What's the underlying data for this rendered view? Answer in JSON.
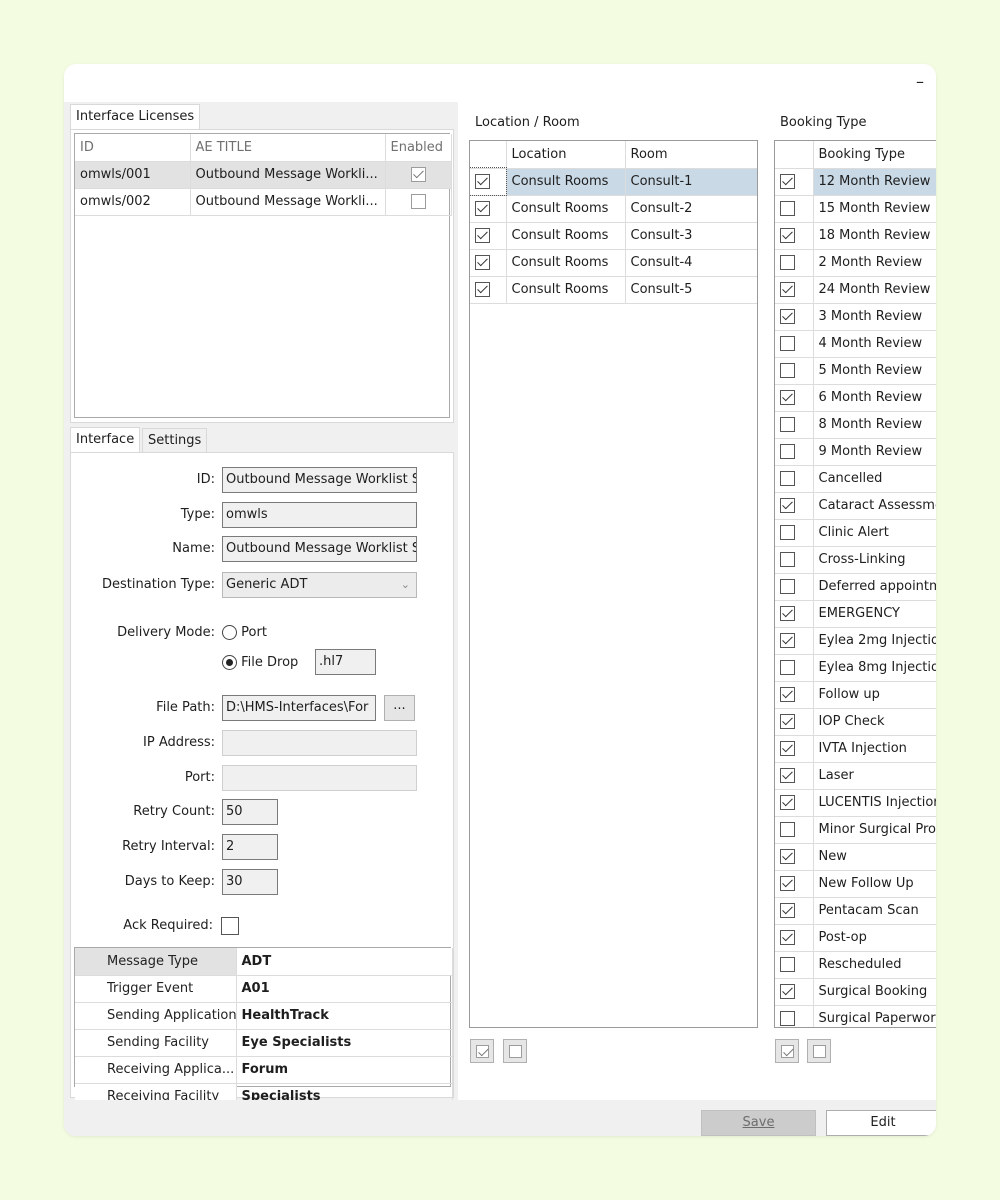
{
  "window": {
    "minimize_glyph": "–"
  },
  "licenses": {
    "tab_label": "Interface Licenses",
    "columns": [
      "ID",
      "AE TITLE",
      "Enabled"
    ],
    "rows": [
      {
        "id": "omwls/001",
        "ae_title": "Outbound Message Workli...",
        "enabled": true
      },
      {
        "id": "omwls/002",
        "ae_title": "Outbound Message Workli...",
        "enabled": false
      }
    ]
  },
  "interface_tabs": {
    "interface": "Interface",
    "settings": "Settings"
  },
  "form": {
    "id_label": "ID:",
    "id_value": "Outbound Message Worklist S",
    "type_label": "Type:",
    "type_value": "omwls",
    "name_label": "Name:",
    "name_value": "Outbound Message Worklist S",
    "dest_label": "Destination Type:",
    "dest_value": "Generic ADT",
    "delivery_label": "Delivery Mode:",
    "port_option": "Port",
    "filedrop_option": "File Drop",
    "file_ext": ".hl7",
    "filepath_label": "File Path:",
    "filepath_value": "D:\\HMS-Interfaces\\For",
    "browse_label": "...",
    "ip_label": "IP Address:",
    "port_label": "Port:",
    "retry_count_label": "Retry Count:",
    "retry_count_value": "50",
    "retry_interval_label": "Retry Interval:",
    "retry_interval_value": "2",
    "days_label": "Days to Keep:",
    "days_value": "30",
    "ack_label": "Ack Required:",
    "ack_checked": false
  },
  "message_props": [
    {
      "key": "Message Type",
      "value": "ADT"
    },
    {
      "key": "Trigger Event",
      "value": "A01"
    },
    {
      "key": "Sending Application",
      "value": "HealthTrack"
    },
    {
      "key": "Sending Facility",
      "value": "Eye Specialists"
    },
    {
      "key": "Receiving Applica...",
      "value": "Forum"
    },
    {
      "key": "Receiving Facility",
      "value": "Specialists"
    }
  ],
  "locations": {
    "title": "Location / Room",
    "columns": [
      "Location",
      "Room"
    ],
    "rows": [
      {
        "location": "Consult Rooms",
        "room": "Consult-1",
        "checked": true
      },
      {
        "location": "Consult Rooms",
        "room": "Consult-2",
        "checked": true
      },
      {
        "location": "Consult Rooms",
        "room": "Consult-3",
        "checked": true
      },
      {
        "location": "Consult Rooms",
        "room": "Consult-4",
        "checked": true
      },
      {
        "location": "Consult Rooms",
        "room": "Consult-5",
        "checked": true
      }
    ]
  },
  "booking": {
    "title": "Booking Type",
    "column": "Booking Type",
    "rows": [
      {
        "label": "12 Month Review",
        "checked": true
      },
      {
        "label": "15 Month Review",
        "checked": false
      },
      {
        "label": "18 Month Review",
        "checked": true
      },
      {
        "label": "2 Month Review",
        "checked": false
      },
      {
        "label": "24 Month Review",
        "checked": true
      },
      {
        "label": "3 Month Review",
        "checked": true
      },
      {
        "label": "4 Month Review",
        "checked": false
      },
      {
        "label": "5 Month Review",
        "checked": false
      },
      {
        "label": "6 Month Review",
        "checked": true
      },
      {
        "label": "8 Month Review",
        "checked": false
      },
      {
        "label": "9 Month Review",
        "checked": false
      },
      {
        "label": "Cancelled",
        "checked": false
      },
      {
        "label": "Cataract Assessme",
        "checked": true
      },
      {
        "label": "Clinic Alert",
        "checked": false
      },
      {
        "label": "Cross-Linking",
        "checked": false
      },
      {
        "label": "Deferred appointm",
        "checked": false
      },
      {
        "label": "EMERGENCY",
        "checked": true
      },
      {
        "label": "Eylea 2mg Injectio",
        "checked": true
      },
      {
        "label": "Eylea 8mg Injectio",
        "checked": false
      },
      {
        "label": "Follow up",
        "checked": true
      },
      {
        "label": "IOP Check",
        "checked": true
      },
      {
        "label": "IVTA Injection",
        "checked": true
      },
      {
        "label": "Laser",
        "checked": true
      },
      {
        "label": "LUCENTIS Injectior",
        "checked": true
      },
      {
        "label": "Minor Surgical Proc",
        "checked": false
      },
      {
        "label": "New",
        "checked": true
      },
      {
        "label": "New Follow Up",
        "checked": true
      },
      {
        "label": "Pentacam Scan",
        "checked": true
      },
      {
        "label": "Post-op",
        "checked": true
      },
      {
        "label": "Rescheduled",
        "checked": false
      },
      {
        "label": "Surgical Booking",
        "checked": true
      },
      {
        "label": "Surgical Paperwork",
        "checked": false
      }
    ]
  },
  "footer": {
    "save_label": "Save",
    "edit_label": "Edit"
  }
}
